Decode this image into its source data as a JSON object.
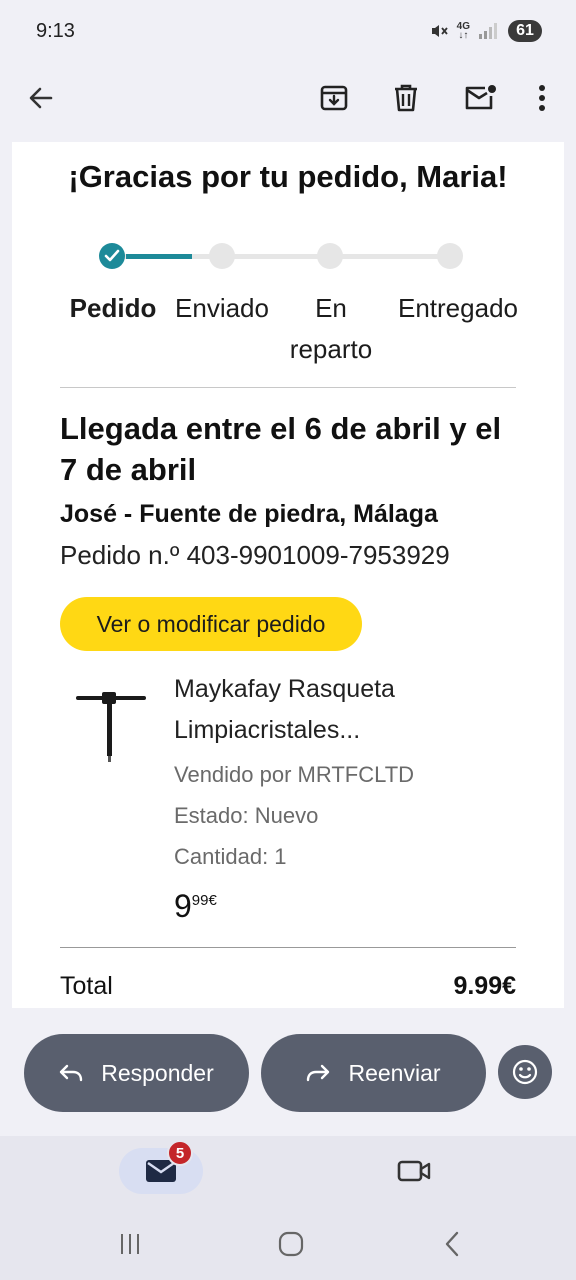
{
  "status_bar": {
    "time": "9:13",
    "network": "4G",
    "battery": "61"
  },
  "email": {
    "greeting": "¡Gracias por tu pedido, Maria!",
    "progress_steps": [
      {
        "label": "Pedido",
        "done": true
      },
      {
        "label": "Enviado",
        "done": false
      },
      {
        "label": "En reparto",
        "done": false
      },
      {
        "label": "Entregado",
        "done": false
      }
    ],
    "arrival": "Llegada entre el 6 de abril y el 7 de abril",
    "address": "José - Fuente de piedra, Málaga",
    "order_number": "Pedido n.º 403-9901009-7953929",
    "view_button": "Ver o modificar pedido",
    "product": {
      "title": "Maykafay Rasqueta Limpiacristales...",
      "seller": "Vendido por MRTFCLTD",
      "condition": "Estado: Nuevo",
      "quantity": "Cantidad: 1",
      "price_whole": "9",
      "price_fraction": "99€"
    },
    "total_label": "Total",
    "total_value": "9.99€"
  },
  "actions": {
    "reply": "Responder",
    "forward": "Reenviar"
  },
  "bottom_nav": {
    "mail_badge": "5"
  },
  "colors": {
    "accent": "#1d8a99",
    "button_yellow": "#ffd814",
    "action_bg": "#595f6e",
    "badge": "#c4262a"
  }
}
